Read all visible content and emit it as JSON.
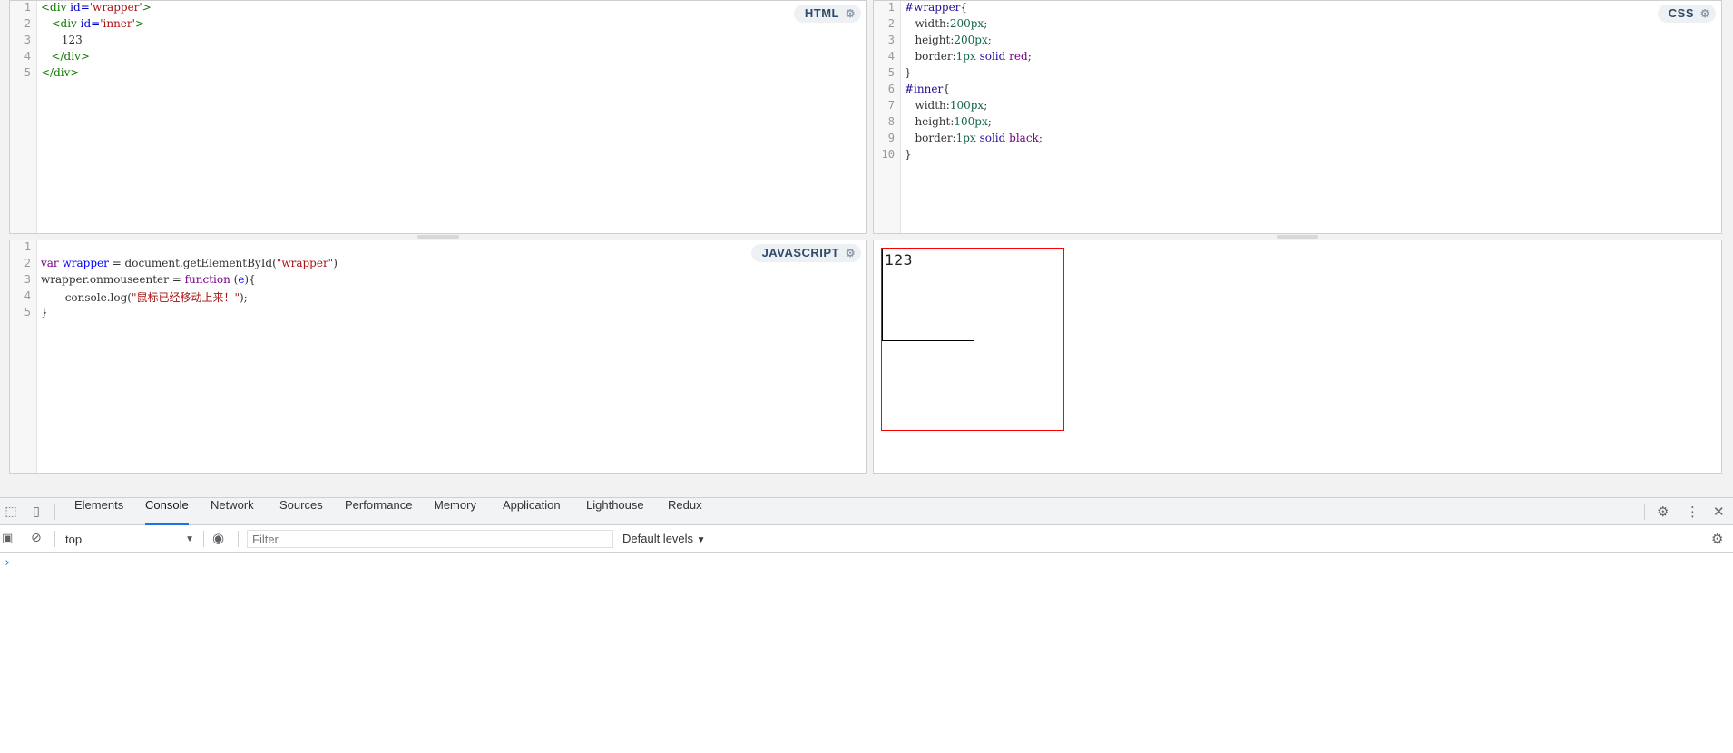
{
  "html_pane": {
    "label": "HTML",
    "line_numbers": [
      "1",
      "2",
      "3",
      "4",
      "5"
    ]
  },
  "css_pane": {
    "label": "CSS",
    "line_numbers": [
      "1",
      "2",
      "3",
      "4",
      "5",
      "6",
      "7",
      "8",
      "9",
      "10"
    ]
  },
  "js_pane": {
    "label": "JAVASCRIPT",
    "line_numbers": [
      "1",
      "2",
      "3",
      "4",
      "5"
    ]
  },
  "code": {
    "html": [
      [
        [
          "tag",
          "<div "
        ],
        [
          "attr",
          "id="
        ],
        [
          "str",
          "'wrapper'"
        ],
        [
          "tag",
          ">"
        ]
      ],
      [
        [
          "plain",
          "   "
        ],
        [
          "tag",
          "<div "
        ],
        [
          "attr",
          "id="
        ],
        [
          "str",
          "'inner'"
        ],
        [
          "tag",
          ">"
        ]
      ],
      [
        [
          "plain",
          "      123"
        ]
      ],
      [
        [
          "plain",
          "   "
        ],
        [
          "tag",
          "</div>"
        ]
      ],
      [
        [
          "tag",
          "</div>"
        ]
      ]
    ],
    "css": [
      [
        [
          "atom",
          "#wrapper"
        ],
        [
          "plain",
          "{"
        ]
      ],
      [
        [
          "plain",
          "   width:"
        ],
        [
          "num",
          "200px"
        ],
        [
          "plain",
          ";"
        ]
      ],
      [
        [
          "plain",
          "   height:"
        ],
        [
          "num",
          "200px"
        ],
        [
          "plain",
          ";"
        ]
      ],
      [
        [
          "plain",
          "   border:"
        ],
        [
          "num",
          "1px"
        ],
        [
          "plain",
          " "
        ],
        [
          "atom",
          "solid"
        ],
        [
          "plain",
          " "
        ],
        [
          "kw",
          "red"
        ],
        [
          "plain",
          ";"
        ]
      ],
      [
        [
          "plain",
          "}"
        ]
      ],
      [
        [
          "atom",
          "#inner"
        ],
        [
          "plain",
          "{"
        ]
      ],
      [
        [
          "plain",
          "   width:"
        ],
        [
          "num",
          "100px"
        ],
        [
          "plain",
          ";"
        ]
      ],
      [
        [
          "plain",
          "   height:"
        ],
        [
          "num",
          "100px"
        ],
        [
          "plain",
          ";"
        ]
      ],
      [
        [
          "plain",
          "   border:"
        ],
        [
          "num",
          "1px"
        ],
        [
          "plain",
          " "
        ],
        [
          "atom",
          "solid"
        ],
        [
          "plain",
          " "
        ],
        [
          "kw",
          "black"
        ],
        [
          "plain",
          ";"
        ]
      ],
      [
        [
          "plain",
          "}"
        ]
      ]
    ],
    "js": [
      [
        [
          "plain",
          ""
        ]
      ],
      [
        [
          "kw",
          "var"
        ],
        [
          "plain",
          " "
        ],
        [
          "var",
          "wrapper"
        ],
        [
          "plain",
          " = document.getElementById("
        ],
        [
          "str",
          "\"wrapper\""
        ],
        [
          "plain",
          ")"
        ]
      ],
      [
        [
          "plain",
          "wrapper.onmouseenter = "
        ],
        [
          "kw",
          "function"
        ],
        [
          "plain",
          " ("
        ],
        [
          "var",
          "e"
        ],
        [
          "plain",
          "){"
        ]
      ],
      [
        [
          "plain",
          "       console.log("
        ],
        [
          "str",
          "\"鼠标已经移动上来！\""
        ],
        [
          "plain",
          ");"
        ]
      ],
      [
        [
          "plain",
          "}"
        ]
      ]
    ]
  },
  "output": {
    "inner_text": "123"
  },
  "devtools": {
    "tabs": [
      "Elements",
      "Console",
      "Network",
      "Sources",
      "Performance",
      "Memory",
      "Application",
      "Lighthouse",
      "Redux"
    ],
    "active_tab": "Console",
    "context": "top",
    "filter_placeholder": "Filter",
    "levels_label": "Default levels",
    "prompt": "›"
  },
  "icons": {
    "inspect": "inspect-element-icon",
    "device": "device-toolbar-icon",
    "settings": "gear-icon",
    "more": "kebab-menu-icon",
    "close": "close-icon",
    "sidebar": "console-sidebar-icon",
    "clear": "clear-console-icon",
    "eye": "live-expression-eye-icon"
  }
}
